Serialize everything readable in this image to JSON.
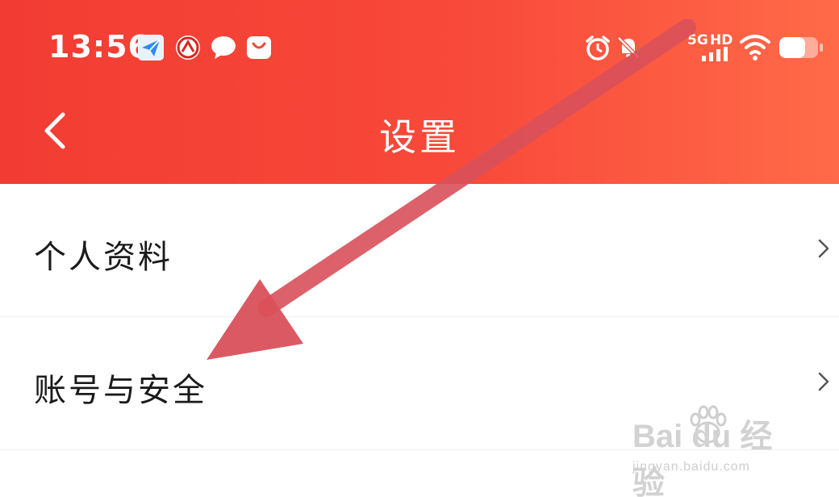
{
  "status_bar": {
    "time": "13:56",
    "network_type": "5G",
    "hd_label": "HD",
    "icons": [
      "paper-plane-icon",
      "bank-icon",
      "chat-bubble-icon",
      "shopping-bag-icon",
      "alarm-icon",
      "bell-off-icon",
      "signal-icon",
      "wifi-icon",
      "battery-icon"
    ]
  },
  "nav": {
    "title": "设置",
    "back_icon": "chevron-left-icon"
  },
  "settings": {
    "items": [
      {
        "label": "个人资料"
      },
      {
        "label": "账号与安全"
      }
    ]
  },
  "watermark": {
    "main": "Bai du 经验",
    "sub": "jingyan.baidu.com"
  },
  "colors": {
    "header_start": "#f23c33",
    "header_end": "#ff6a48",
    "annotation_arrow": "#d9505a"
  }
}
